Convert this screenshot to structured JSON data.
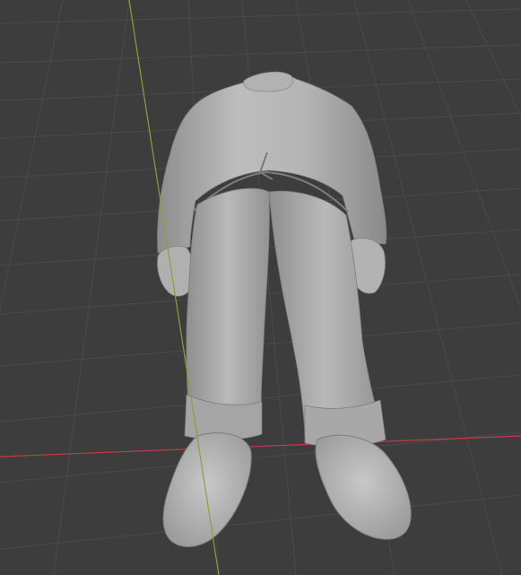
{
  "viewport": {
    "background_color": "#3d3d3d",
    "grid_color": "#4a4a4a",
    "x_axis_color": "#c23b46",
    "y_axis_color": "#7fa63a",
    "mesh_color": "#a9a9a9",
    "mesh_light_color": "#c7c7c7",
    "mesh_shadow_color": "#7f7f7f",
    "object_description_icon": "mesh-object-icon"
  }
}
